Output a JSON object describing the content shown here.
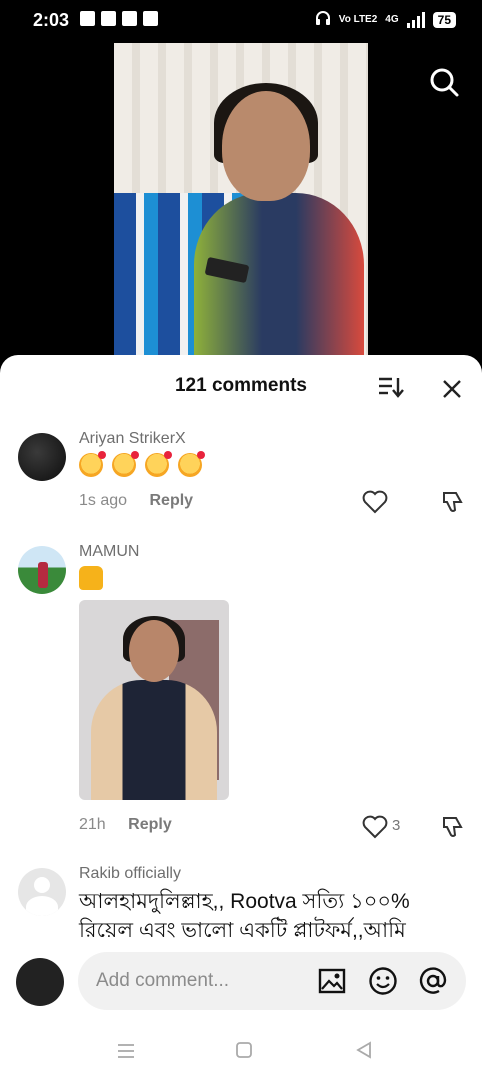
{
  "status_bar": {
    "time": "2:03",
    "network_label": "Vo LTE2",
    "network_type": "4G",
    "battery": "75"
  },
  "video": {
    "search_icon": "search-icon"
  },
  "comments_sheet": {
    "title": "121 comments",
    "sort_icon": "sort-icon",
    "close_icon": "close-icon",
    "comments": [
      {
        "author": "Ariyan StrikerX",
        "text_icon": "smiling-face-with-hearts-emoji",
        "emoji_count": 4,
        "time": "1s ago",
        "reply_label": "Reply",
        "likes": ""
      },
      {
        "author": "MAMUN",
        "text_icon": "thumbs-up-emoji",
        "has_image": true,
        "time": "21h",
        "reply_label": "Reply",
        "likes": "3"
      },
      {
        "author": "Rakib officially",
        "text": "আলহামদুলিল্লাহ,, Rootva সত্যি ১০০% রিয়েল এবং ভালো একটি প্লাটফর্ম,,আমি"
      }
    ]
  },
  "input": {
    "placeholder": "Add comment...",
    "image_icon": "image-icon",
    "emoji_icon": "emoji-icon",
    "at_icon": "at-icon"
  },
  "colors": {
    "accent_text": "#111111",
    "muted_text": "#8a8a8a",
    "sheet_bg": "#ffffff",
    "input_bg": "#f1f1f1"
  }
}
